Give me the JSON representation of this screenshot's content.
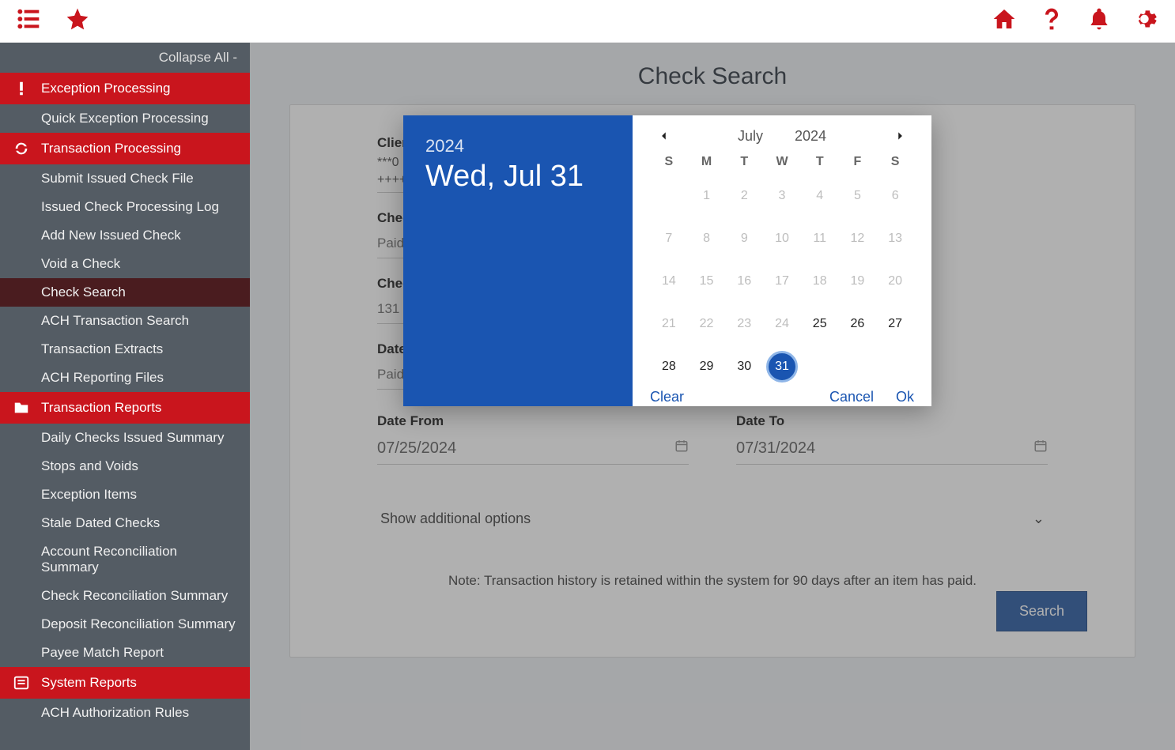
{
  "topbar": {},
  "sidebar": {
    "collapse_label": "Collapse All -",
    "sections": [
      {
        "label": "Exception Processing",
        "icon": "alert",
        "items": [
          {
            "label": "Quick Exception Processing"
          }
        ]
      },
      {
        "label": "Transaction Processing",
        "icon": "refresh",
        "items": [
          {
            "label": "Submit Issued Check File"
          },
          {
            "label": "Issued Check Processing Log"
          },
          {
            "label": "Add New Issued Check"
          },
          {
            "label": "Void a Check"
          },
          {
            "label": "Check Search",
            "active": true
          },
          {
            "label": "ACH Transaction Search"
          },
          {
            "label": "Transaction Extracts"
          },
          {
            "label": "ACH Reporting Files"
          }
        ]
      },
      {
        "label": "Transaction Reports",
        "icon": "folder",
        "items": [
          {
            "label": "Daily Checks Issued Summary"
          },
          {
            "label": "Stops and Voids"
          },
          {
            "label": "Exception Items"
          },
          {
            "label": "Stale Dated Checks"
          },
          {
            "label": "Account Reconciliation Summary"
          },
          {
            "label": "Check Reconciliation Summary"
          },
          {
            "label": "Deposit Reconciliation Summary"
          },
          {
            "label": "Payee Match Report"
          }
        ]
      },
      {
        "label": "System Reports",
        "icon": "news",
        "items": [
          {
            "label": "ACH Authorization Rules"
          }
        ]
      }
    ]
  },
  "page": {
    "title": "Check Search",
    "client_label": "Client",
    "client_lines": [
      "***0",
      "++++"
    ],
    "check_status_label": "Check Status",
    "check_status_value": "Paid",
    "check_number_label": "Check Number",
    "check_number_value": "131",
    "date_label": "Date",
    "date_value": "Paid",
    "date_from_label": "Date From",
    "date_from_value": "07/25/2024",
    "date_to_label": "Date To",
    "date_to_value": "07/31/2024",
    "show_additional": "Show additional options",
    "note": "Note: Transaction history is retained within the system for 90 days after an item has paid.",
    "search_button": "Search"
  },
  "datepicker": {
    "year": "2024",
    "selected_long": "Wed, Jul 31",
    "month_label": "July",
    "year_label": "2024",
    "dow": [
      "S",
      "M",
      "T",
      "W",
      "T",
      "F",
      "S"
    ],
    "weeks": [
      [
        {
          "n": "",
          "muted": true
        },
        {
          "n": "1",
          "muted": true
        },
        {
          "n": "2",
          "muted": true
        },
        {
          "n": "3",
          "muted": true
        },
        {
          "n": "4",
          "muted": true
        },
        {
          "n": "5",
          "muted": true
        },
        {
          "n": "6",
          "muted": true
        }
      ],
      [
        {
          "n": "7",
          "muted": true
        },
        {
          "n": "8",
          "muted": true
        },
        {
          "n": "9",
          "muted": true
        },
        {
          "n": "10",
          "muted": true
        },
        {
          "n": "11",
          "muted": true
        },
        {
          "n": "12",
          "muted": true
        },
        {
          "n": "13",
          "muted": true
        }
      ],
      [
        {
          "n": "14",
          "muted": true
        },
        {
          "n": "15",
          "muted": true
        },
        {
          "n": "16",
          "muted": true
        },
        {
          "n": "17",
          "muted": true
        },
        {
          "n": "18",
          "muted": true
        },
        {
          "n": "19",
          "muted": true
        },
        {
          "n": "20",
          "muted": true
        }
      ],
      [
        {
          "n": "21",
          "muted": true
        },
        {
          "n": "22",
          "muted": true
        },
        {
          "n": "23",
          "muted": true
        },
        {
          "n": "24",
          "muted": true
        },
        {
          "n": "25"
        },
        {
          "n": "26"
        },
        {
          "n": "27"
        }
      ],
      [
        {
          "n": "28"
        },
        {
          "n": "29"
        },
        {
          "n": "30"
        },
        {
          "n": "31",
          "selected": true
        },
        {
          "n": ""
        },
        {
          "n": ""
        },
        {
          "n": ""
        }
      ]
    ],
    "clear": "Clear",
    "cancel": "Cancel",
    "ok": "Ok"
  }
}
